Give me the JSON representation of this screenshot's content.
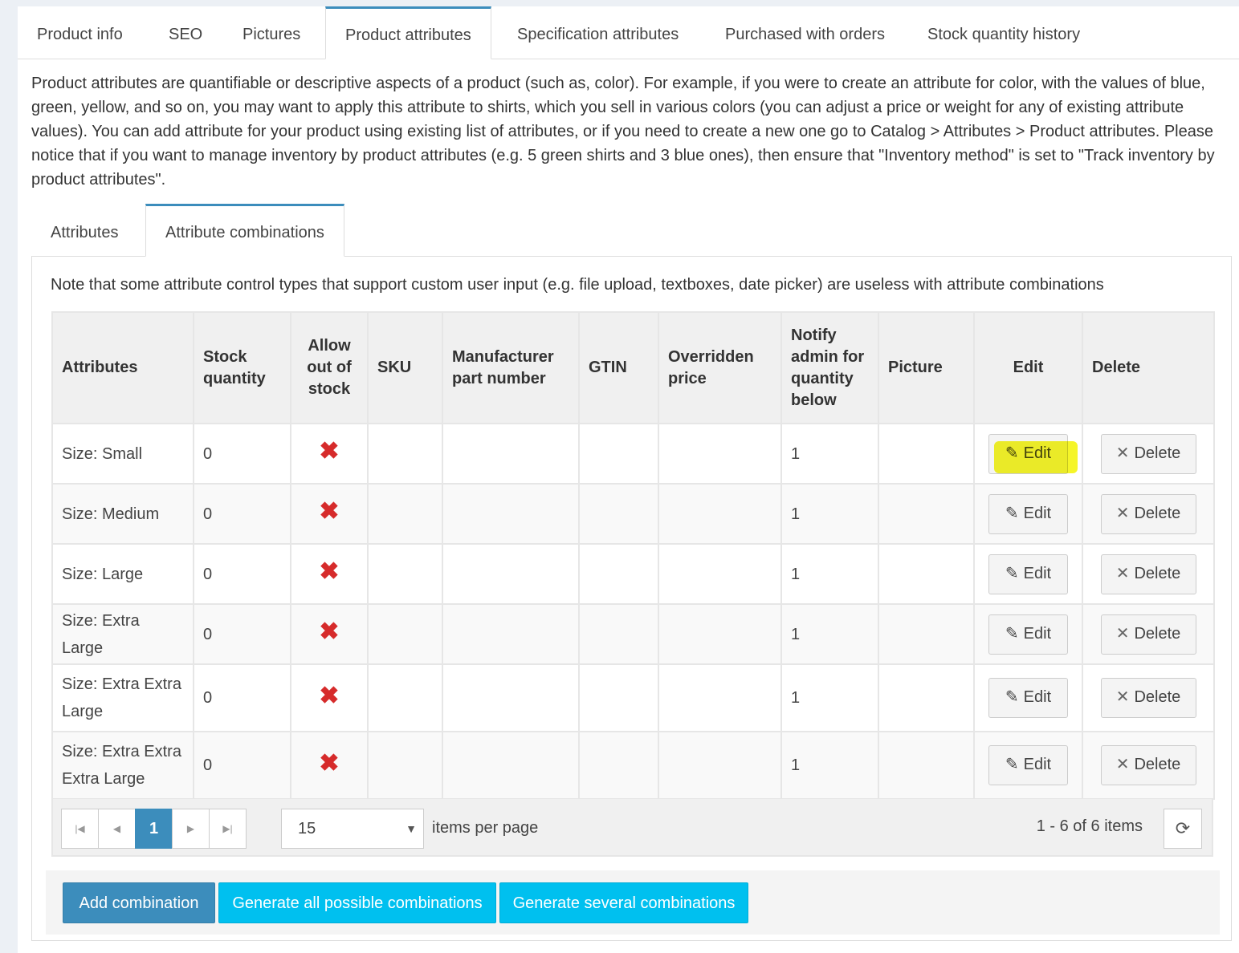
{
  "top_tabs": [
    {
      "label": "Product info"
    },
    {
      "label": "SEO"
    },
    {
      "label": "Pictures"
    },
    {
      "label": "Product attributes"
    },
    {
      "label": "Specification attributes"
    },
    {
      "label": "Purchased with orders"
    },
    {
      "label": "Stock quantity history"
    }
  ],
  "description": "Product attributes are quantifiable or descriptive aspects of a product (such as, color). For example, if you were to create an attribute for color, with the values of blue, green, yellow, and so on, you may want to apply this attribute to shirts, which you sell in various colors (you can adjust a price or weight for any of existing attribute values). You can add attribute for your product using existing list of attributes, or if you need to create a new one go to Catalog > Attributes > Product attributes. Please notice that if you want to manage inventory by product attributes (e.g. 5 green shirts and 3 blue ones), then ensure that \"Inventory method\" is set to \"Track inventory by product attributes\".",
  "sub_tabs": [
    {
      "label": "Attributes"
    },
    {
      "label": "Attribute combinations"
    }
  ],
  "note": "Note that some attribute control types that support custom user input (e.g. file upload, textboxes, date picker) are useless with attribute combinations",
  "table": {
    "headers": {
      "attributes": "Attributes",
      "stock_quantity": "Stock quantity",
      "allow_out_of_stock": "Allow out of stock",
      "sku": "SKU",
      "manufacturer_part_number": "Manufacturer part number",
      "gtin": "GTIN",
      "overridden_price": "Overridden price",
      "notify_admin": "Notify admin for quantity below",
      "picture": "Picture",
      "edit": "Edit",
      "delete": "Delete"
    },
    "rows": [
      {
        "attributes": "Size: Small",
        "stock": "0",
        "sku": "",
        "mpn": "",
        "gtin": "",
        "price": "",
        "notify": "1",
        "picture": ""
      },
      {
        "attributes": "Size: Medium",
        "stock": "0",
        "sku": "",
        "mpn": "",
        "gtin": "",
        "price": "",
        "notify": "1",
        "picture": ""
      },
      {
        "attributes": "Size: Large",
        "stock": "0",
        "sku": "",
        "mpn": "",
        "gtin": "",
        "price": "",
        "notify": "1",
        "picture": ""
      },
      {
        "attributes": "Size: Extra Large",
        "stock": "0",
        "sku": "",
        "mpn": "",
        "gtin": "",
        "price": "",
        "notify": "1",
        "picture": ""
      },
      {
        "attributes": "Size: Extra Extra Large",
        "stock": "0",
        "sku": "",
        "mpn": "",
        "gtin": "",
        "price": "",
        "notify": "1",
        "picture": ""
      },
      {
        "attributes": "Size: Extra Extra Extra Large",
        "stock": "0",
        "sku": "",
        "mpn": "",
        "gtin": "",
        "price": "",
        "notify": "1",
        "picture": ""
      }
    ],
    "edit_label": "Edit",
    "delete_label": "Delete",
    "allow_out_of_stock_icon": "x-mark-icon"
  },
  "pager": {
    "current_page": "1",
    "page_size": "15",
    "items_per_page_label": "items per page",
    "range": "1 - 6 of 6 items"
  },
  "buttons": {
    "add_combination": "Add combination",
    "generate_all": "Generate all possible combinations",
    "generate_several": "Generate several combinations"
  },
  "colors": {
    "accent": "#3c8dbc",
    "info": "#00c0ef",
    "danger": "#d62b2b",
    "highlight": "#f5f51d"
  }
}
